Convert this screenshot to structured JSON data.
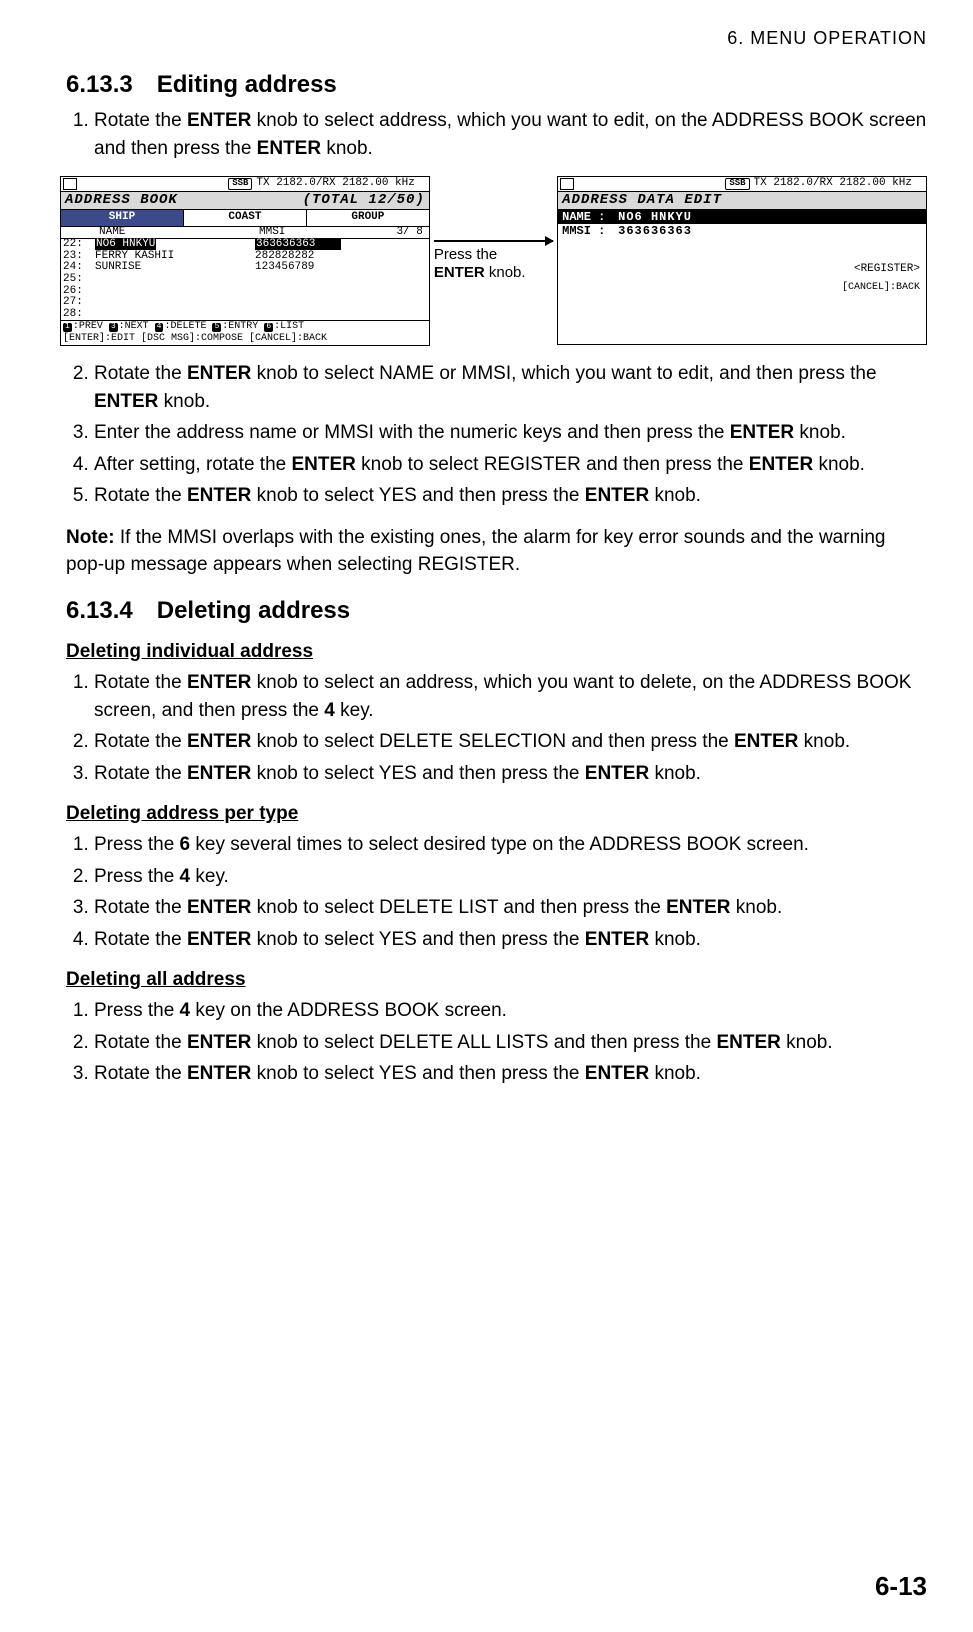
{
  "running_head": "6.  MENU  OPERATION",
  "sec1": {
    "num": "6.13.3",
    "title": "Editing address"
  },
  "sec2": {
    "num": "6.13.4",
    "title": "Deleting address"
  },
  "steps_a": [
    {
      "pre": "Rotate the ",
      "b1": "ENTER",
      "mid": " knob to select address, which you want to edit, on the ADDRESS BOOK screen and then press the ",
      "b2": "ENTER",
      "post": " knob."
    }
  ],
  "fig": {
    "left": {
      "freq": "TX 2182.0/RX 2182.00 kHz",
      "title_l": "ADDRESS BOOK",
      "title_r": "(TOTAL  12/50)",
      "tabs": [
        "SHIP",
        "COAST",
        "GROUP"
      ],
      "head_name": "NAME",
      "head_mmsi": "MMSI",
      "head_pg": "3/ 8",
      "rows": [
        {
          "idx": "22:",
          "name": "NO6 HNKYU",
          "mmsi": "363636363",
          "sel": true
        },
        {
          "idx": "23:",
          "name": "FERRY KASHII",
          "mmsi": "282828282"
        },
        {
          "idx": "24:",
          "name": "SUNRISE",
          "mmsi": "123456789"
        },
        {
          "idx": "25:",
          "name": "",
          "mmsi": ""
        },
        {
          "idx": "26:",
          "name": "",
          "mmsi": ""
        },
        {
          "idx": "27:",
          "name": "",
          "mmsi": ""
        },
        {
          "idx": "28:",
          "name": "",
          "mmsi": ""
        }
      ],
      "hints1_keys": [
        "1",
        "3",
        "4",
        "5",
        "6"
      ],
      "hints1_labels": [
        ":PREV",
        ":NEXT",
        ":DELETE",
        ":ENTRY",
        ":LIST"
      ],
      "hints2": "[ENTER]:EDIT   [DSC MSG]:COMPOSE  [CANCEL]:BACK"
    },
    "mid": {
      "l1": "Press the",
      "l2": "ENTER",
      "l3": " knob."
    },
    "right": {
      "freq": "TX 2182.0/RX 2182.00 kHz",
      "title": "ADDRESS DATA EDIT",
      "name_lab": "NAME :",
      "name_val": "NO6 HNKYU",
      "mmsi_lab": "MMSI :",
      "mmsi_val": "363636363",
      "register": "<REGISTER>",
      "cancel": "[CANCEL]:BACK"
    }
  },
  "steps_b": [
    {
      "pre": "Rotate the ",
      "b1": "ENTER",
      "mid": " knob to select NAME or MMSI, which you want to edit, and then press the ",
      "b2": "ENTER",
      "post": " knob."
    },
    {
      "pre": "Enter the address name or MMSI with the numeric keys and then press the ",
      "b1": "ENTER",
      "post": " knob."
    },
    {
      "pre": "After setting, rotate the ",
      "b1": "ENTER",
      "mid": " knob to select REGISTER and then press the ",
      "b2": "ENTER",
      "post": " knob."
    },
    {
      "pre": "Rotate the ",
      "b1": "ENTER",
      "mid": " knob to select YES and then press the ",
      "b2": "ENTER",
      "post": " knob."
    }
  ],
  "note": {
    "label": "Note:",
    "text": " If the MMSI overlaps with the existing ones, the alarm for key error sounds and the warning pop-up message appears when selecting REGISTER."
  },
  "sub1": "Deleting individual address",
  "steps_c": [
    {
      "pre": "Rotate the ",
      "b1": "ENTER",
      "mid": " knob to select an address, which you want to delete, on the ADDRESS BOOK screen, and then press the ",
      "b2": "4",
      "post": " key."
    },
    {
      "pre": "Rotate the ",
      "b1": "ENTER",
      "mid": " knob to select DELETE SELECTION and then press the ",
      "b2": "ENTER",
      "post": " knob."
    },
    {
      "pre": "Rotate the ",
      "b1": "ENTER",
      "mid": " knob to select YES and then press the ",
      "b2": "ENTER",
      "post": " knob."
    }
  ],
  "sub2": "Deleting address per type",
  "steps_d": [
    {
      "pre": "Press the ",
      "b1": "6",
      "post": " key several times to select desired type on the ADDRESS BOOK screen."
    },
    {
      "pre": "Press the ",
      "b1": "4",
      "post": " key."
    },
    {
      "pre": "Rotate the ",
      "b1": "ENTER",
      "mid": " knob to select DELETE LIST and then press the ",
      "b2": "ENTER",
      "post": " knob."
    },
    {
      "pre": "Rotate the ",
      "b1": "ENTER",
      "mid": " knob to select YES and then press the ",
      "b2": "ENTER",
      "post": " knob."
    }
  ],
  "sub3": "Deleting all address",
  "steps_e": [
    {
      "pre": "Press the ",
      "b1": "4",
      "post": " key on the ADDRESS BOOK screen."
    },
    {
      "pre": "Rotate the ",
      "b1": "ENTER",
      "mid": " knob to select DELETE ALL LISTS and then press the ",
      "b2": "ENTER",
      "post": " knob."
    },
    {
      "pre": "Rotate the ",
      "b1": "ENTER",
      "mid": " knob to select YES and then press the ",
      "b2": "ENTER",
      "post": " knob."
    }
  ],
  "page_num": "6-13",
  "ssb": "SSB"
}
